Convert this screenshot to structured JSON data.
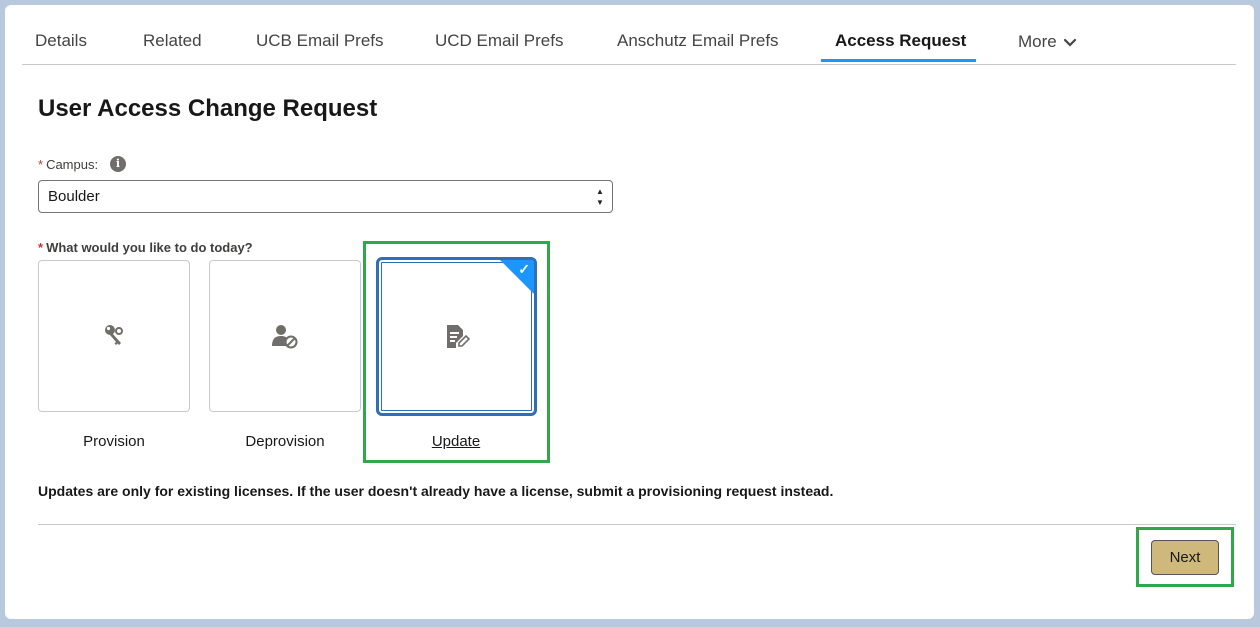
{
  "tabs": [
    {
      "label": "Details"
    },
    {
      "label": "Related"
    },
    {
      "label": "UCB Email Prefs"
    },
    {
      "label": "UCD Email Prefs"
    },
    {
      "label": "Anschutz Email Prefs"
    },
    {
      "label": "Access Request",
      "active": true
    },
    {
      "label": "More",
      "icon": "chevron-down-icon"
    }
  ],
  "form": {
    "title": "User Access Change Request",
    "required_mark": "*",
    "campus_label": "Campus:",
    "campus_value": "Boulder",
    "question_label": "What would you like to do today?",
    "options": [
      {
        "label": "Provision",
        "icon": "key-icon",
        "selected": false
      },
      {
        "label": "Deprovision",
        "icon": "user-block-icon",
        "selected": false
      },
      {
        "label": "Update",
        "icon": "document-edit-icon",
        "selected": true
      }
    ],
    "note": "Updates are only for existing licenses. If the user doesn't already have a license, submit a provisioning request instead.",
    "next_label": "Next"
  },
  "colors": {
    "accent": "#1b96ff",
    "selected_border": "#2e6fb5",
    "highlight": "#2ea84a",
    "next_button": "#cfb87c",
    "required": "#c23934"
  }
}
